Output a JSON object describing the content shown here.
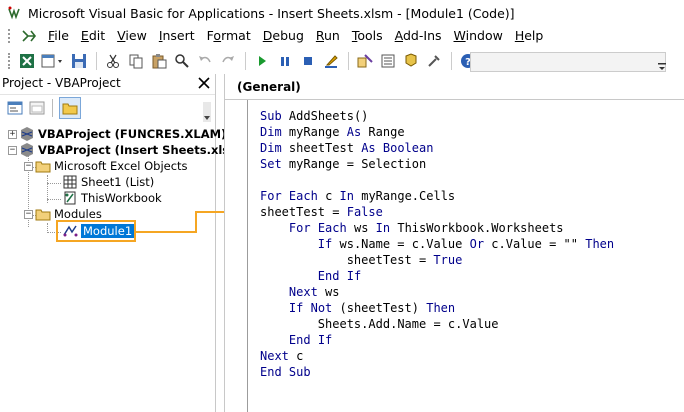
{
  "window": {
    "title": "Microsoft Visual Basic for Applications - Insert Sheets.xlsm - [Module1 (Code)]"
  },
  "menu": {
    "items": [
      {
        "label": "File",
        "underline": "F",
        "rest": "ile"
      },
      {
        "label": "Edit",
        "underline": "E",
        "rest": "dit"
      },
      {
        "label": "View",
        "underline": "V",
        "rest": "iew"
      },
      {
        "label": "Insert",
        "underline": "I",
        "rest": "nsert"
      },
      {
        "label": "Format",
        "pre": "F",
        "underline": "o",
        "rest": "rmat"
      },
      {
        "label": "Debug",
        "underline": "D",
        "rest": "ebug"
      },
      {
        "label": "Run",
        "underline": "R",
        "rest": "un"
      },
      {
        "label": "Tools",
        "underline": "T",
        "rest": "ools"
      },
      {
        "label": "Add-Ins",
        "underline": "A",
        "rest": "dd-Ins"
      },
      {
        "label": "Window",
        "underline": "W",
        "rest": "indow"
      },
      {
        "label": "Help",
        "underline": "H",
        "rest": "elp"
      }
    ]
  },
  "project_explorer": {
    "title": "Project - VBAProject",
    "tree": {
      "project1": "VBAProject (FUNCRES.XLAM)",
      "project2": "VBAProject (Insert Sheets.xlsı",
      "excel_objects": "Microsoft Excel Objects",
      "sheet1": "Sheet1 (List)",
      "thisworkbook": "ThisWorkbook",
      "modules": "Modules",
      "module1": "Module1"
    }
  },
  "code_window": {
    "object_dropdown": "(General)",
    "lines": [
      "Sub AddSheets()",
      "Dim myRange As Range",
      "Dim sheetTest As Boolean",
      "Set myRange = Selection",
      "",
      "For Each c In myRange.Cells",
      "sheetTest = False",
      "    For Each ws In ThisWorkbook.Worksheets",
      "        If ws.Name = c.Value Or c.Value = \"\" Then",
      "            sheetTest = True",
      "        End If",
      "    Next ws",
      "    If Not (sheetTest) Then",
      "        Sheets.Add.Name = c.Value",
      "    End If",
      "Next c",
      "End Sub"
    ]
  },
  "colors": {
    "keyword": "#00008b",
    "highlight": "#f5a623",
    "selection": "#0078d7"
  }
}
